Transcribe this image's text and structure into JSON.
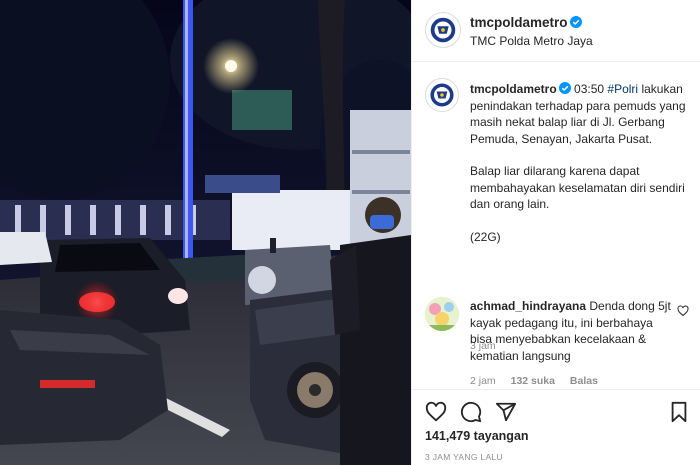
{
  "post": {
    "username": "tmcpoldametro",
    "subtitle": "TMC Polda Metro Jaya",
    "verified": true
  },
  "caption": {
    "username": "tmcpoldametro",
    "time_inline": "03:50",
    "hashtag": "#Polri",
    "line1": "lakukan penindakan terhadap para pemuds yang masih nekat balap liar di Jl. Gerbang Pemuda, Senayan, Jakarta Pusat.",
    "line2": "Balap liar dilarang karena dapat membahayakan keselamatan diri sendiri dan orang lain.",
    "line3": "(22G)",
    "ago": "3 jam"
  },
  "comment": {
    "username": "achmad_hindrayana",
    "text": "Denda dong 5jt kayak pedagang itu, ini berbahaya bisa menyebabkan kecelakaan & kematian langsung",
    "ago": "2 jam",
    "likes": "132 suka",
    "reply": "Balas"
  },
  "actions": {
    "like_icon": "heart-icon",
    "comment_icon": "comment-icon",
    "share_icon": "share-icon",
    "save_icon": "bookmark-icon"
  },
  "stats": {
    "views": "141,479 tayangan",
    "timestamp": "3 JAM YANG LALU"
  },
  "colors": {
    "verified": "#0095f6",
    "hashtag": "#00376b",
    "muted": "#8e8e8e",
    "police_blue": "#1e3a8a"
  }
}
